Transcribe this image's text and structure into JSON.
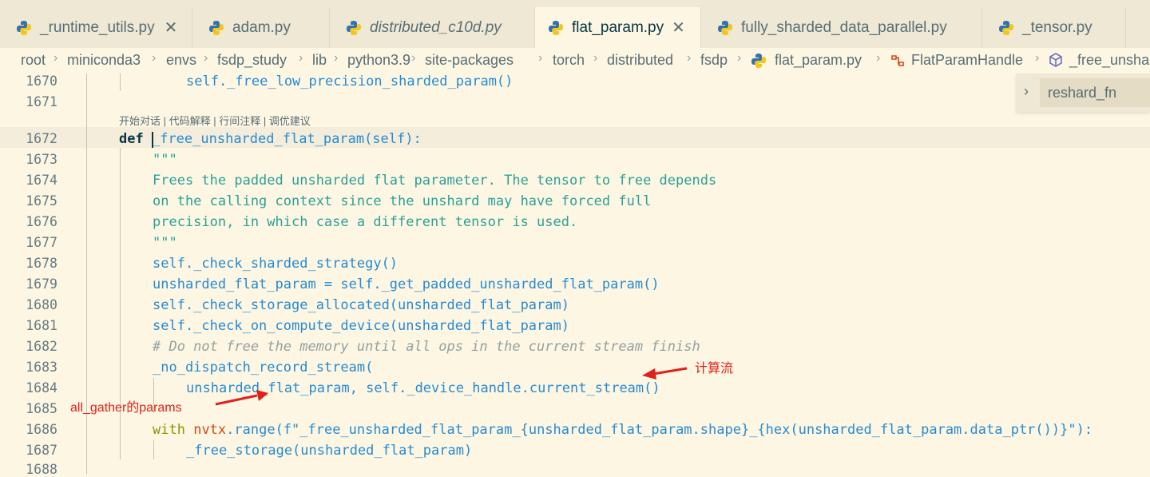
{
  "tabs": [
    {
      "label": "_runtime_utils.py",
      "close": "✕"
    },
    {
      "label": "adam.py"
    },
    {
      "label": "distributed_c10d.py"
    },
    {
      "label": "flat_param.py",
      "close": "✕"
    },
    {
      "label": "fully_sharded_data_parallel.py"
    },
    {
      "label": "_tensor.py"
    }
  ],
  "breadcrumb": {
    "root": "root",
    "miniconda3": "miniconda3",
    "envs": "envs",
    "fsdp_study": "fsdp_study",
    "lib": "lib",
    "python": "python3.9",
    "site": "site-packages",
    "torch": "torch",
    "distributed": "distributed",
    "fsdp": "fsdp",
    "file": "flat_param.py",
    "cls": "FlatParamHandle",
    "method": "_free_unsha"
  },
  "sticky": {
    "label": "reshard_fn"
  },
  "codelens": "开始对话 | 代码解释 | 行间注释 | 调优建议",
  "line_numbers": [
    "1670",
    "1671",
    "1672",
    "1673",
    "1674",
    "1675",
    "1676",
    "1677",
    "1678",
    "1679",
    "1680",
    "1681",
    "1682",
    "1683",
    "1684",
    "1685",
    "1686",
    "1687",
    "1688"
  ],
  "code": {
    "l1670": "self._free_low_precision_sharded_param()",
    "l1672_def": "def",
    "l1672_rest": "_free_unsharded_flat_param(self):",
    "l1673": "\"\"\"",
    "l1674": "Frees the padded unsharded flat parameter. The tensor to free depends",
    "l1675": "on the calling context since the unshard may have forced full",
    "l1676": "precision, in which case a different tensor is used.",
    "l1677": "\"\"\"",
    "l1678": "self._check_sharded_strategy()",
    "l1679": "unsharded_flat_param = self._get_padded_unsharded_flat_param()",
    "l1680": "self._check_storage_allocated(unsharded_flat_param)",
    "l1681": "self._check_on_compute_device(unsharded_flat_param)",
    "l1682": "# Do not free the memory until all ops in the current stream finish",
    "l1683": "_no_dispatch_record_stream(",
    "l1684": "unsharded_flat_param, self._device_handle.current_stream()",
    "l1686_with": "with",
    "l1686_nvtx": "nvtx",
    "l1686_rest": ".range(f\"_free_unsharded_flat_param_{unsharded_flat_param.shape}_{hex(unsharded_flat_param.data_ptr())}\"):",
    "l1687": "_free_storage(unsharded_flat_param)"
  },
  "annotations": {
    "compute_stream": "计算流",
    "allgather_params": "all_gather的params"
  },
  "colors": {
    "arrow": "#e0201a",
    "python_blue": "#3572A5",
    "python_yellow": "#f5c518"
  }
}
